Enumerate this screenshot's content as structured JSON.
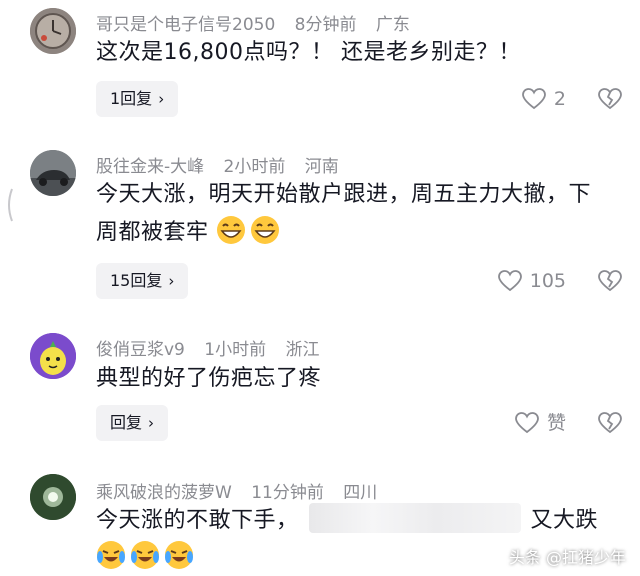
{
  "comments": [
    {
      "username": "哥只是个电子信号2050",
      "time": "8分钟前",
      "location": "广东",
      "text": "这次是16,800点吗？！ 还是老乡别走？！",
      "reply_label": "1回复",
      "likes": "2"
    },
    {
      "username": "股往金来-大峰",
      "time": "2小时前",
      "location": "河南",
      "text": "今天大涨，明天开始散户跟进，周五主力大撤，下周都被套牢",
      "reply_label": "15回复",
      "likes": "105"
    },
    {
      "username": "俊俏豆浆v9",
      "time": "1小时前",
      "location": "浙江",
      "text": "典型的好了伤疤忘了疼",
      "reply_label": "回复",
      "likes": "赞"
    },
    {
      "username": "乘风破浪的菠萝W",
      "time": "11分钟前",
      "location": "四川",
      "text_start": "今天涨的不敢下手，",
      "text_end": "又大跌"
    }
  ],
  "watermark": "头条 @扛猪少年",
  "colors": {
    "meta": "#8a8b91",
    "text": "#161823",
    "button_bg": "#f2f2f4"
  },
  "icons": [
    "heart-icon",
    "broken-heart-icon",
    "chevron-right-icon",
    "grinning-emoji-icon",
    "crying-laughing-emoji-icon"
  ]
}
